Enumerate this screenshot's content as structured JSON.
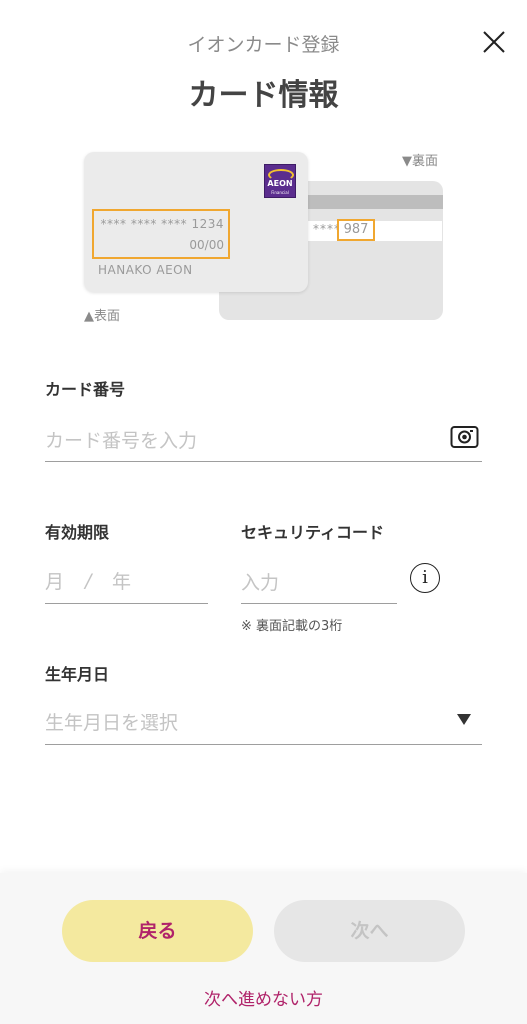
{
  "header": {
    "subtitle": "イオンカード登録",
    "title": "カード情報"
  },
  "card_illustration": {
    "front_label": "▲表面",
    "back_label": "▼裏面",
    "brand": "AEON",
    "brand_sub": "Financial",
    "masked_number": "**** **** **** 1234",
    "expiry": "00/00",
    "holder": "HANAKO AEON",
    "back_masked": "****",
    "security_code": "987",
    "highlight_color": "#f0a730"
  },
  "form": {
    "card_number": {
      "label": "カード番号",
      "placeholder": "カード番号を入力"
    },
    "expiry": {
      "label": "有効期限",
      "month_placeholder": "月",
      "separator": "/",
      "year_placeholder": "年"
    },
    "security_code": {
      "label": "セキュリティコード",
      "placeholder": "入力",
      "hint": "※ 裏面記載の3桁"
    },
    "birthdate": {
      "label": "生年月日",
      "placeholder": "生年月日を選択"
    }
  },
  "footer": {
    "back_label": "戻る",
    "next_label": "次へ",
    "cannot_proceed_link": "次へ進めない方"
  },
  "colors": {
    "accent": "#b0236a",
    "back_button_bg": "#f4e99f",
    "next_button_bg_disabled": "#e6e6e6"
  }
}
